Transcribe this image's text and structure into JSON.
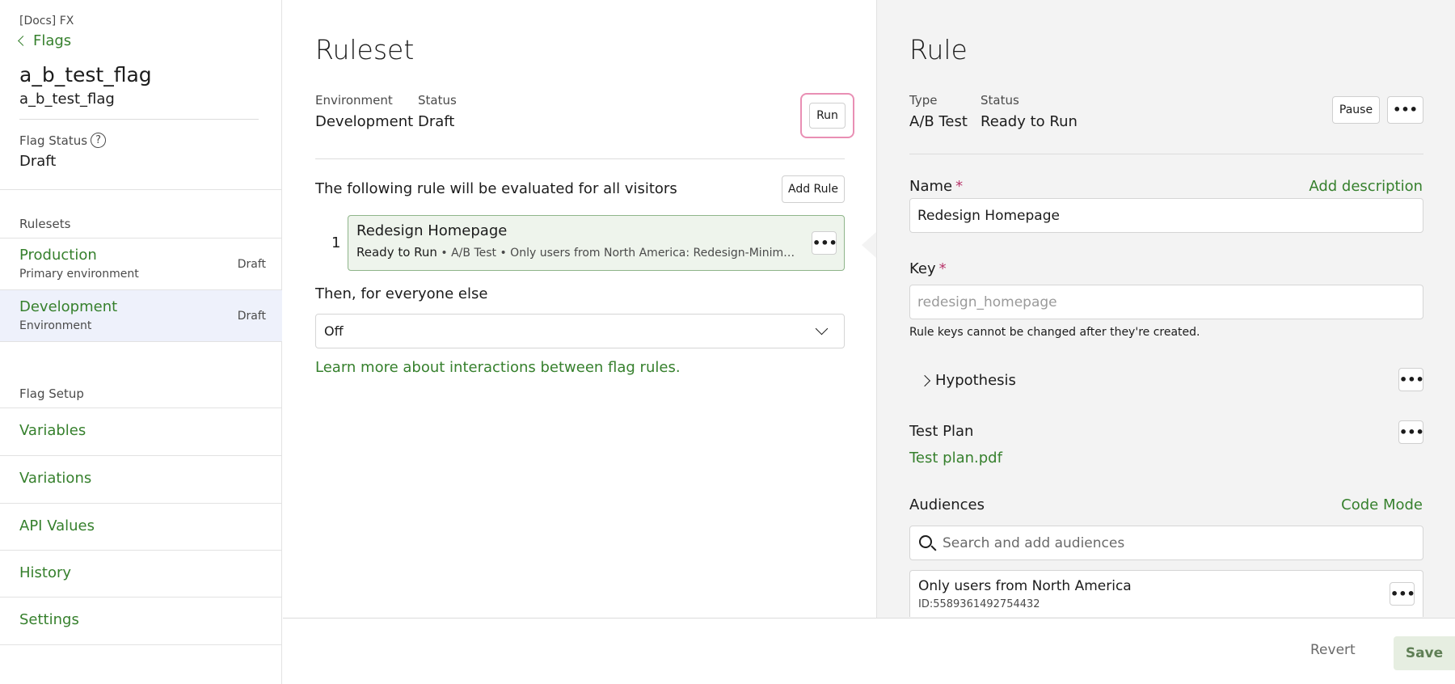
{
  "sidebar": {
    "project": "[Docs] FX",
    "back_label": "Flags",
    "flag_name": "a_b_test_flag",
    "flag_key": "a_b_test_flag",
    "flag_status_label": "Flag Status",
    "flag_status_value": "Draft",
    "rulesets_heading": "Rulesets",
    "rulesets": [
      {
        "name": "Production",
        "sub": "Primary environment",
        "badge": "Draft"
      },
      {
        "name": "Development",
        "sub": "Environment",
        "badge": "Draft"
      }
    ],
    "setup_heading": "Flag Setup",
    "setup_items": [
      "Variables",
      "Variations",
      "API Values",
      "History",
      "Settings"
    ]
  },
  "ruleset": {
    "title": "Ruleset",
    "env_label": "Environment",
    "env_value": "Development",
    "status_label": "Status",
    "status_value": "Draft",
    "run_label": "Run",
    "eval_text": "The following rule will be evaluated for all visitors",
    "add_rule_label": "Add Rule",
    "rule": {
      "number": "1",
      "name": "Redesign Homepage",
      "status": "Ready to Run",
      "description": " • A/B Test • Only users from North America: Redesign-Minimalist, Redesign-Bold"
    },
    "else_text": "Then, for everyone else",
    "else_value": "Off",
    "learn_more": "Learn more about interactions between flag rules."
  },
  "rule_panel": {
    "title": "Rule",
    "type_label": "Type",
    "type_value": "A/B Test",
    "status_label": "Status",
    "status_value": "Ready to Run",
    "pause_label": "Pause",
    "name_label": "Name",
    "required_mark": "*",
    "add_description": "Add description",
    "name_value": "Redesign Homepage",
    "key_label": "Key",
    "key_placeholder": "redesign_homepage",
    "key_hint": "Rule keys cannot be changed after they're created.",
    "hypothesis_label": "Hypothesis",
    "test_plan_label": "Test Plan",
    "test_plan_file": "Test plan.pdf",
    "audiences_label": "Audiences",
    "code_mode": "Code Mode",
    "search_placeholder": "Search and add audiences",
    "audience": {
      "name": "Only users from North America",
      "id": "ID:5589361492754432"
    }
  },
  "footer": {
    "revert_label": "Revert",
    "save_label": "Save"
  },
  "icons": {
    "more": "more-horizontal-icon",
    "help": "help-circle-icon",
    "search": "search-icon"
  },
  "colors": {
    "link_green": "#36802d",
    "highlight_pink": "#e98fb4",
    "required": "#b8346a"
  }
}
